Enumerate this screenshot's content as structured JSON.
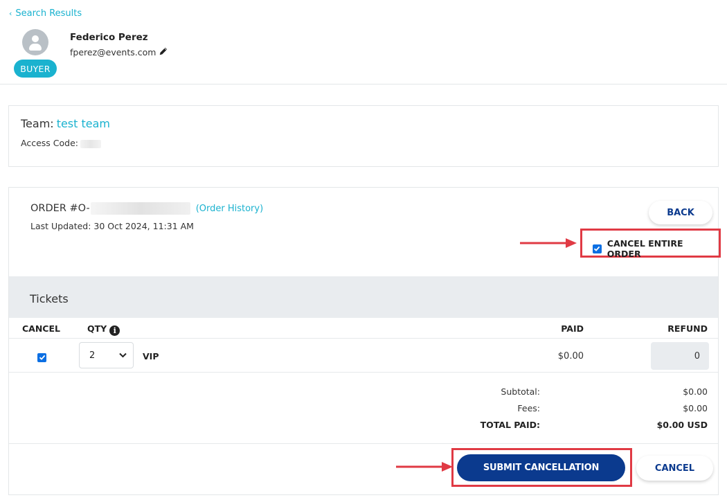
{
  "nav": {
    "back_label": "Search Results"
  },
  "customer": {
    "name": "Federico Perez",
    "email": "fperez@events.com",
    "role_badge": "BUYER"
  },
  "team": {
    "label": "Team:",
    "name": "test team",
    "access_code_label": "Access Code:"
  },
  "order": {
    "number_prefix": "ORDER #O-",
    "history_link": "(Order History)",
    "last_updated": "Last Updated: 30 Oct 2024, 11:31 AM",
    "back_button": "BACK",
    "cancel_entire_order_label": "CANCEL ENTIRE ORDER",
    "cancel_entire_order_checked": true
  },
  "tickets": {
    "section_title": "Tickets",
    "columns": {
      "cancel": "CANCEL",
      "qty": "QTY",
      "paid": "PAID",
      "refund": "REFUND"
    },
    "rows": [
      {
        "cancel_checked": true,
        "qty": "2",
        "tier": "VIP",
        "paid": "$0.00",
        "refund": "0"
      }
    ]
  },
  "summary": {
    "subtotal_label": "Subtotal:",
    "subtotal_value": "$0.00",
    "fees_label": "Fees:",
    "fees_value": "$0.00",
    "total_label": "TOTAL PAID:",
    "total_value": "$0.00 USD"
  },
  "actions": {
    "submit_label": "SUBMIT CANCELLATION",
    "cancel_label": "CANCEL"
  },
  "colors": {
    "accent": "#1ab2cf",
    "primary": "#0b3a8e",
    "highlight": "#e03a44",
    "checkbox": "#0b6fe3"
  }
}
